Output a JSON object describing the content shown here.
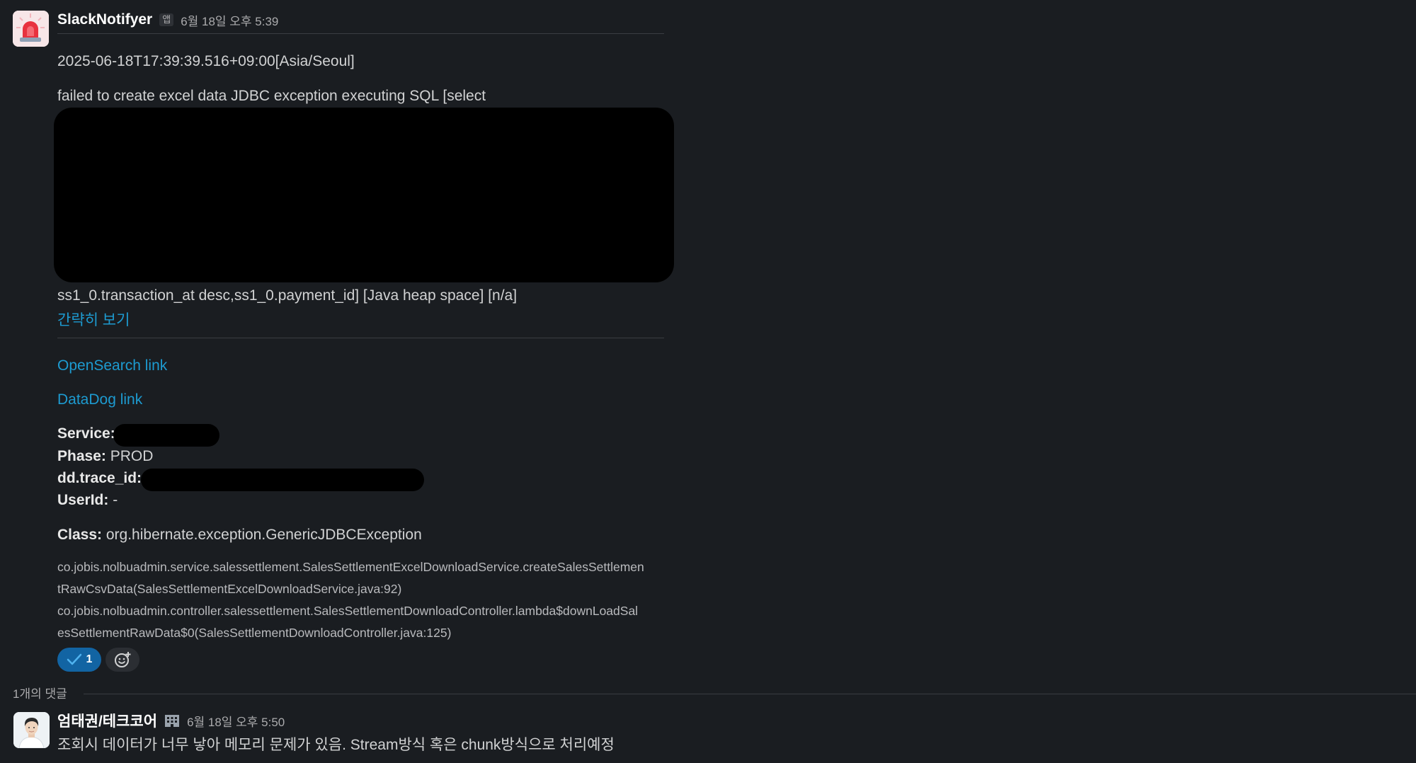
{
  "message": {
    "sender": "SlackNotifyer",
    "app_badge": "앱",
    "timestamp": "6월 18일 오후 5:39",
    "datetime_line": "2025-06-18T17:39:39.516+09:00[Asia/Seoul]",
    "error_line_1": "failed to create excel data JDBC exception executing SQL [select",
    "error_line_2": "ss1_0.transaction_at desc,ss1_0.payment_id] [Java heap space] [n/a]",
    "collapse_link": "간략히 보기",
    "opensearch_link": "OpenSearch link",
    "datadog_link": "DataDog link",
    "service_label": "Service:",
    "phase_label": "Phase:",
    "phase_value": "PROD",
    "trace_label": "dd.trace_id:",
    "userid_label": "UserId:",
    "userid_value": "-",
    "class_label": "Class:",
    "class_value": "org.hibernate.exception.GenericJDBCException",
    "stack_lines": [
      "co.jobis.nolbuadmin.service.salessettlement.SalesSettlementExcelDownloadService.createSalesSettlemen",
      "tRawCsvData(SalesSettlementExcelDownloadService.java:92)",
      "co.jobis.nolbuadmin.controller.salessettlement.SalesSettlementDownloadController.lambda$downLoadSal",
      "esSettlementRawData$0(SalesSettlementDownloadController.java:125)"
    ],
    "reaction": {
      "icon": "checkmark-icon",
      "count": "1"
    },
    "add_reaction_icon": "add-emoji-icon"
  },
  "thread": {
    "reply_count": "1개의 댓글"
  },
  "reply": {
    "sender": "엄태권/테크코어",
    "status_icon": "office-building-icon",
    "timestamp": "6월 18일 오후 5:50",
    "text": "조회시 데이터가 너무 낳아 메모리 문제가 있음. Stream방식 혹은 chunk방식으로 처리예정"
  },
  "colors": {
    "background": "#1a1d21",
    "link": "#1d9bd1",
    "reaction_active": "#1264a3"
  }
}
